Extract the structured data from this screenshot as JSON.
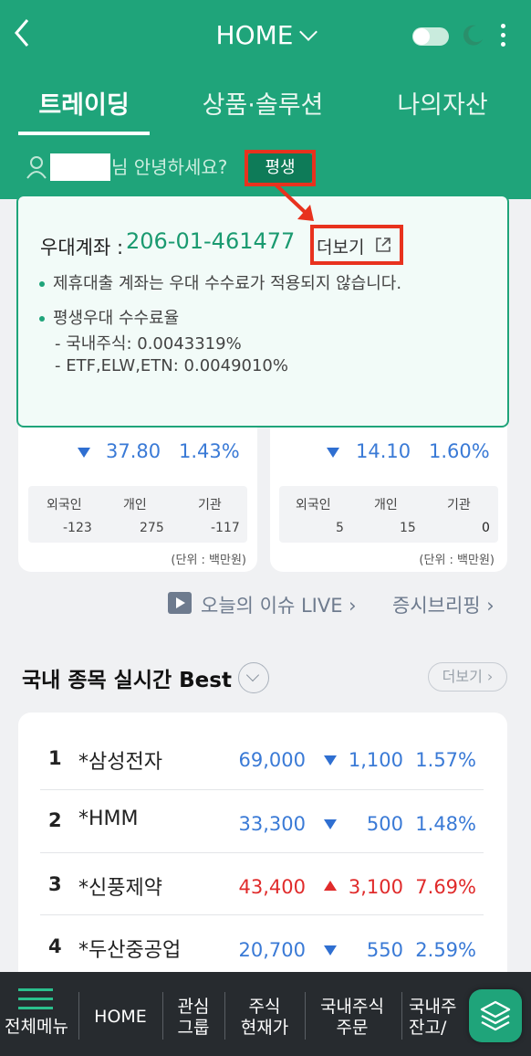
{
  "header": {
    "title": "HOME",
    "tabs": [
      "트레이딩",
      "상품·솔루션",
      "나의자산"
    ],
    "greeting_suffix": "님 안녕하세요?",
    "badge": "평생"
  },
  "popup": {
    "account_label": "우대계좌 :",
    "account_number": "206-01-461477",
    "more_label": "더보기",
    "note": "제휴대출 계좌는 우대 수수료가 적용되지 않습니다.",
    "fee_title": "평생우대 수수료율",
    "fee_domestic": "- 국내주식: 0.0043319%",
    "fee_etf": "- ETF,ELW,ETN: 0.0049010%"
  },
  "index_cards": [
    {
      "change": "37.80",
      "pct": "1.43%",
      "investors": [
        {
          "label": "외국인",
          "value": "-123"
        },
        {
          "label": "개인",
          "value": "275"
        },
        {
          "label": "기관",
          "value": "-117"
        }
      ],
      "unit": "(단위 : 백만원)"
    },
    {
      "change": "14.10",
      "pct": "1.60%",
      "investors": [
        {
          "label": "외국인",
          "value": "5"
        },
        {
          "label": "개인",
          "value": "15"
        },
        {
          "label": "기관",
          "value": "0"
        }
      ],
      "unit": "(단위 : 백만원)"
    }
  ],
  "links": {
    "live": "오늘의 이슈 LIVE",
    "briefing": "증시브리핑"
  },
  "best": {
    "title": "국내 종목 실시간 Best",
    "more": "더보기",
    "rows": [
      {
        "rank": "1",
        "name": "*삼성전자",
        "price": "69,000",
        "dir": "down",
        "change": "1,100",
        "pct": "1.57%"
      },
      {
        "rank": "2",
        "name": "*HMM",
        "price": "33,300",
        "dir": "down",
        "change": "500",
        "pct": "1.48%"
      },
      {
        "rank": "3",
        "name": "*신풍제약",
        "price": "43,400",
        "dir": "up",
        "change": "3,100",
        "pct": "7.69%"
      },
      {
        "rank": "4",
        "name": "*두산중공업",
        "price": "20,700",
        "dir": "down",
        "change": "550",
        "pct": "2.59%"
      }
    ]
  },
  "bottom_nav": {
    "menu": "전체메뉴",
    "home": "HOME",
    "watch_1": "관심",
    "watch_2": "그룹",
    "price_1": "주식",
    "price_2": "현재가",
    "order_1": "국내주식",
    "order_2": "주문",
    "balance_1": "국내주",
    "balance_2": "잔고/"
  },
  "colors": {
    "brand": "#1fa47a",
    "highlight": "#e8321e",
    "down": "#3a7ad6",
    "up": "#e02b2b"
  }
}
